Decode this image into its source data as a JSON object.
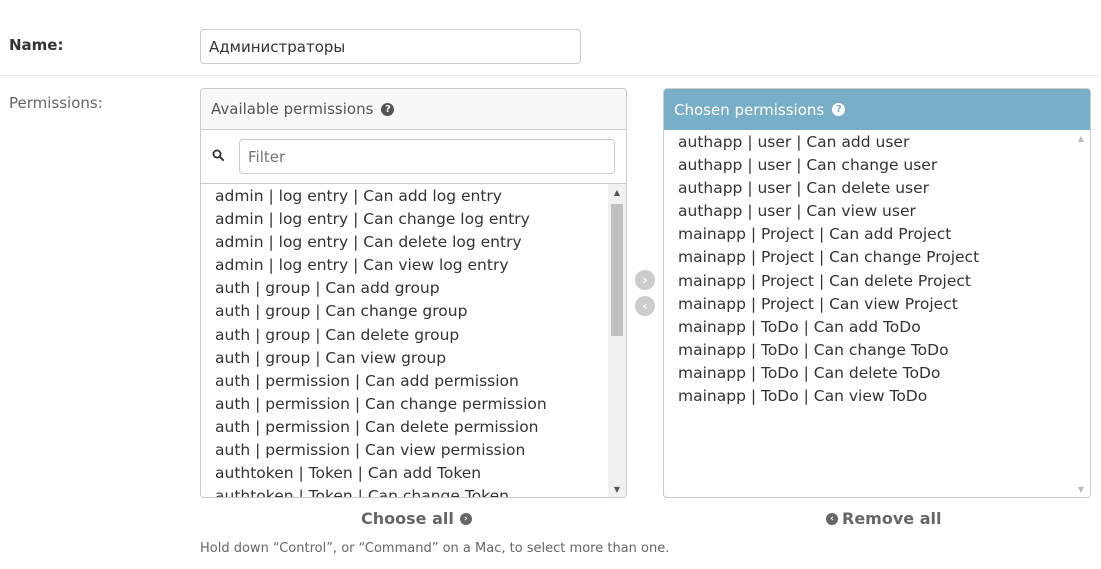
{
  "form": {
    "name_label": "Name:",
    "name_value": "Администраторы",
    "permissions_label": "Permissions:"
  },
  "available": {
    "title": "Available permissions",
    "help_icon": "?",
    "filter_placeholder": "Filter",
    "items": [
      "admin | log entry | Can add log entry",
      "admin | log entry | Can change log entry",
      "admin | log entry | Can delete log entry",
      "admin | log entry | Can view log entry",
      "auth | group | Can add group",
      "auth | group | Can change group",
      "auth | group | Can delete group",
      "auth | group | Can view group",
      "auth | permission | Can add permission",
      "auth | permission | Can change permission",
      "auth | permission | Can delete permission",
      "auth | permission | Can view permission",
      "authtoken | Token | Can add Token",
      "authtoken | Token | Can change Token"
    ]
  },
  "chosen": {
    "title": "Chosen permissions",
    "help_icon": "?",
    "items": [
      "authapp | user | Can add user",
      "authapp | user | Can change user",
      "authapp | user | Can delete user",
      "authapp | user | Can view user",
      "mainapp | Project | Can add Project",
      "mainapp | Project | Can change Project",
      "mainapp | Project | Can delete Project",
      "mainapp | Project | Can view Project",
      "mainapp | ToDo | Can add ToDo",
      "mainapp | ToDo | Can change ToDo",
      "mainapp | ToDo | Can delete ToDo",
      "mainapp | ToDo | Can view ToDo"
    ]
  },
  "actions": {
    "choose_all": "Choose all",
    "remove_all": "Remove all"
  },
  "help_text": "Hold down “Control”, or “Command” on a Mac, to select more than one.",
  "icons": {
    "help": "help-icon",
    "search": "search-icon",
    "add": "arrow-right-circle-icon",
    "remove": "arrow-left-circle-icon"
  },
  "colors": {
    "chosen_header": "#79aec8",
    "text": "#333333",
    "muted": "#666666"
  }
}
